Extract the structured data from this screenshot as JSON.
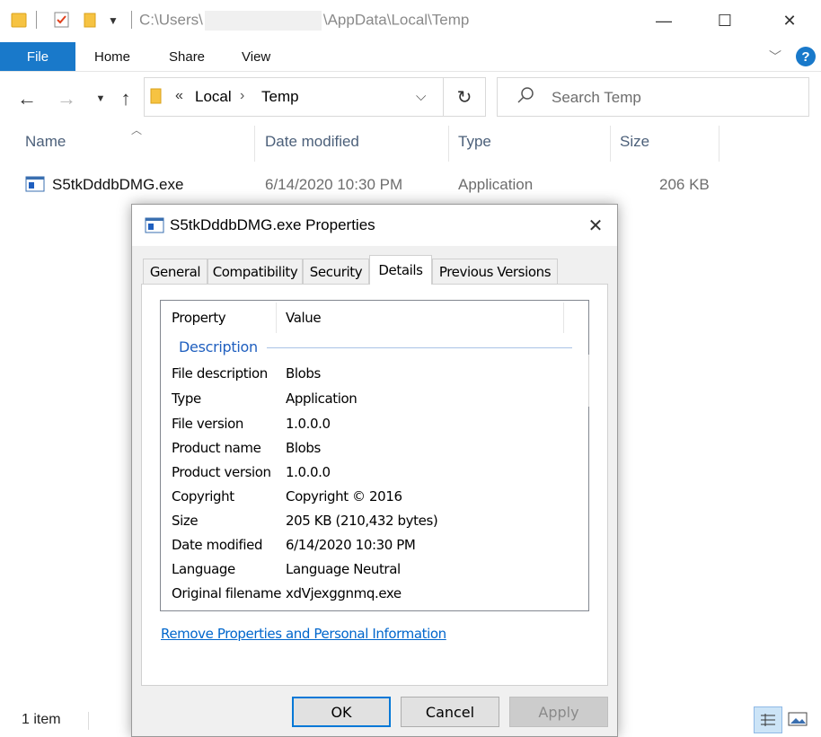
{
  "titlebar": {
    "path_prefix": "C:\\Users\\",
    "path_suffix": "\\AppData\\Local\\Temp",
    "minimize": "—",
    "maximize": "☐",
    "close": "✕"
  },
  "ribbon": {
    "tabs": [
      "File",
      "Home",
      "Share",
      "View"
    ],
    "help": "?"
  },
  "address": {
    "overflow": "«",
    "crumbs": [
      "Local",
      "Temp"
    ],
    "search_placeholder": "Search Temp"
  },
  "columns": [
    "Name",
    "Date modified",
    "Type",
    "Size"
  ],
  "files": [
    {
      "name": "S5tkDddbDMG.exe",
      "date": "6/14/2020 10:30 PM",
      "type": "Application",
      "size": "206 KB"
    }
  ],
  "status": {
    "count": "1 item"
  },
  "dialog": {
    "title": "S5tkDddbDMG.exe Properties",
    "tabs": [
      "General",
      "Compatibility",
      "Security",
      "Details",
      "Previous Versions"
    ],
    "selected_tab": "Details",
    "headers": {
      "property": "Property",
      "value": "Value"
    },
    "section": "Description",
    "properties": [
      {
        "name": "File description",
        "value": "Blobs"
      },
      {
        "name": "Type",
        "value": "Application"
      },
      {
        "name": "File version",
        "value": "1.0.0.0"
      },
      {
        "name": "Product name",
        "value": "Blobs"
      },
      {
        "name": "Product version",
        "value": "1.0.0.0"
      },
      {
        "name": "Copyright",
        "value": "Copyright © 2016"
      },
      {
        "name": "Size",
        "value": "205 KB (210,432 bytes)"
      },
      {
        "name": "Date modified",
        "value": "6/14/2020 10:30 PM"
      },
      {
        "name": "Language",
        "value": "Language Neutral"
      },
      {
        "name": "Original filename",
        "value": "xdVjexggnmq.exe"
      }
    ],
    "remove_link": "Remove Properties and Personal Information",
    "buttons": {
      "ok": "OK",
      "cancel": "Cancel",
      "apply": "Apply"
    }
  },
  "colors": {
    "accent": "#1979ca",
    "link": "#0066cc",
    "section_header": "#1f5fbf",
    "column_header": "#4c607a"
  }
}
